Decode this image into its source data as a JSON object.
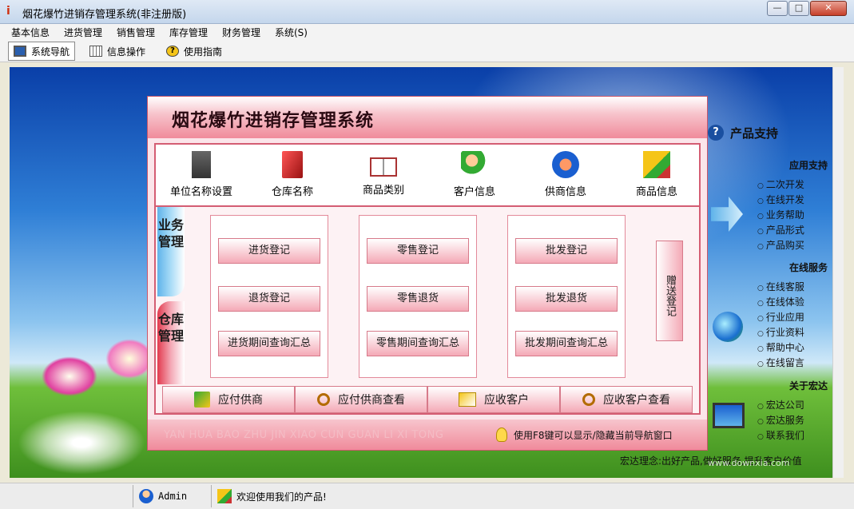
{
  "window": {
    "title": "烟花爆竹进销存管理系统(非注册版)"
  },
  "menu": [
    "基本信息",
    "进货管理",
    "销售管理",
    "库存管理",
    "财务管理",
    "系统(S)"
  ],
  "toolbar": [
    "系统导航",
    "信息操作",
    "使用指南"
  ],
  "panel": {
    "title": "烟花爆竹进销存管理系统",
    "top_items": [
      "单位名称设置",
      "仓库名称",
      "商品类别",
      "客户信息",
      "供商信息",
      "商品信息"
    ],
    "side_tabs": {
      "business": "业务管理",
      "warehouse": "仓库管理"
    },
    "purchase": [
      "进货登记",
      "退货登记",
      "进货期间查询汇总"
    ],
    "retail": [
      "零售登记",
      "零售退货",
      "零售期间查询汇总"
    ],
    "wholesale": [
      "批发登记",
      "批发退货",
      "批发期间查询汇总"
    ],
    "gift": "赠送登记",
    "bottom": [
      "应付供商",
      "应付供商查看",
      "应收客户",
      "应收客户查看"
    ],
    "pinyin": "YAN HUA BAO ZHU JIN XIAO CUN GUAN LI XI TONG",
    "hint": "使用F8键可以显示/隐藏当前导航窗口"
  },
  "support": {
    "title": "产品支持",
    "app_support": "应用支持",
    "app_links": [
      "二次开发",
      "在线开发",
      "业务帮助",
      "产品形式",
      "产品购买"
    ],
    "online": "在线服务",
    "online_links": [
      "在线客服",
      "在线体验",
      "行业应用",
      "行业资料",
      "帮助中心",
      "在线留言"
    ],
    "about": "关于宏达",
    "about_links": [
      "宏达公司",
      "宏达服务",
      "联系我们"
    ],
    "slogan": "宏达理念:出好产品,做好服务,提升客户价值"
  },
  "status": {
    "user": "Admin",
    "welcome": "欢迎使用我们的产品!"
  },
  "watermark": "www.downxia.com",
  "colors": {
    "accent": "#f08b9b",
    "border": "#d45d73",
    "title_blue": "#c4d6ec"
  }
}
